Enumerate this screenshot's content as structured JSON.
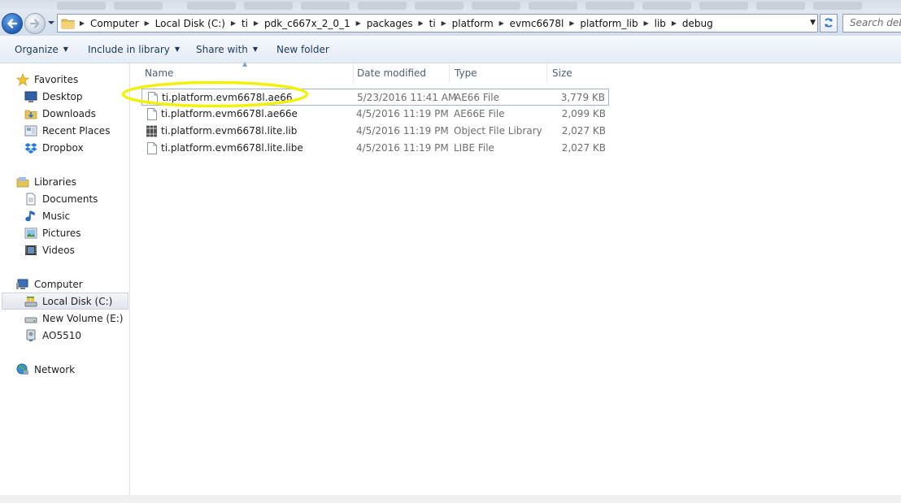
{
  "address": {
    "breadcrumbs": [
      "Computer",
      "Local Disk (C:)",
      "ti",
      "pdk_c667x_2_0_1",
      "packages",
      "ti",
      "platform",
      "evmc6678l",
      "platform_lib",
      "lib",
      "debug"
    ]
  },
  "search": {
    "placeholder": "Search debug"
  },
  "toolbar": {
    "organize": "Organize",
    "include_in_library": "Include in library",
    "share_with": "Share with",
    "new_folder": "New folder"
  },
  "nav": {
    "favorites": "Favorites",
    "desktop": "Desktop",
    "downloads": "Downloads",
    "recent_places": "Recent Places",
    "dropbox": "Dropbox",
    "libraries": "Libraries",
    "documents": "Documents",
    "music": "Music",
    "pictures": "Pictures",
    "videos": "Videos",
    "computer": "Computer",
    "local_disk": "Local Disk (C:)",
    "new_volume": "New Volume (E:)",
    "ao5510": "AO5510",
    "network": "Network"
  },
  "columns": {
    "name": "Name",
    "date_modified": "Date modified",
    "type": "Type",
    "size": "Size"
  },
  "files": [
    {
      "name": "ti.platform.evm6678l.ae66",
      "date": "5/23/2016 11:41 AM",
      "type": "AE66 File",
      "size": "3,779 KB",
      "icon": "generic-file-icon",
      "selected": true
    },
    {
      "name": "ti.platform.evm6678l.ae66e",
      "date": "4/5/2016 11:19 PM",
      "type": "AE66E File",
      "size": "2,099 KB",
      "icon": "generic-file-icon"
    },
    {
      "name": "ti.platform.evm6678l.lite.lib",
      "date": "4/5/2016 11:19 PM",
      "type": "Object File Library",
      "size": "2,027 KB",
      "icon": "library-file-icon"
    },
    {
      "name": "ti.platform.evm6678l.lite.libe",
      "date": "4/5/2016 11:19 PM",
      "type": "LIBE File",
      "size": "2,027 KB",
      "icon": "generic-file-icon"
    }
  ],
  "colors": {
    "highlight_ellipse": "#f3f00a",
    "toolbar_text": "#1e3956",
    "secondary_text": "#6d6d6d"
  }
}
